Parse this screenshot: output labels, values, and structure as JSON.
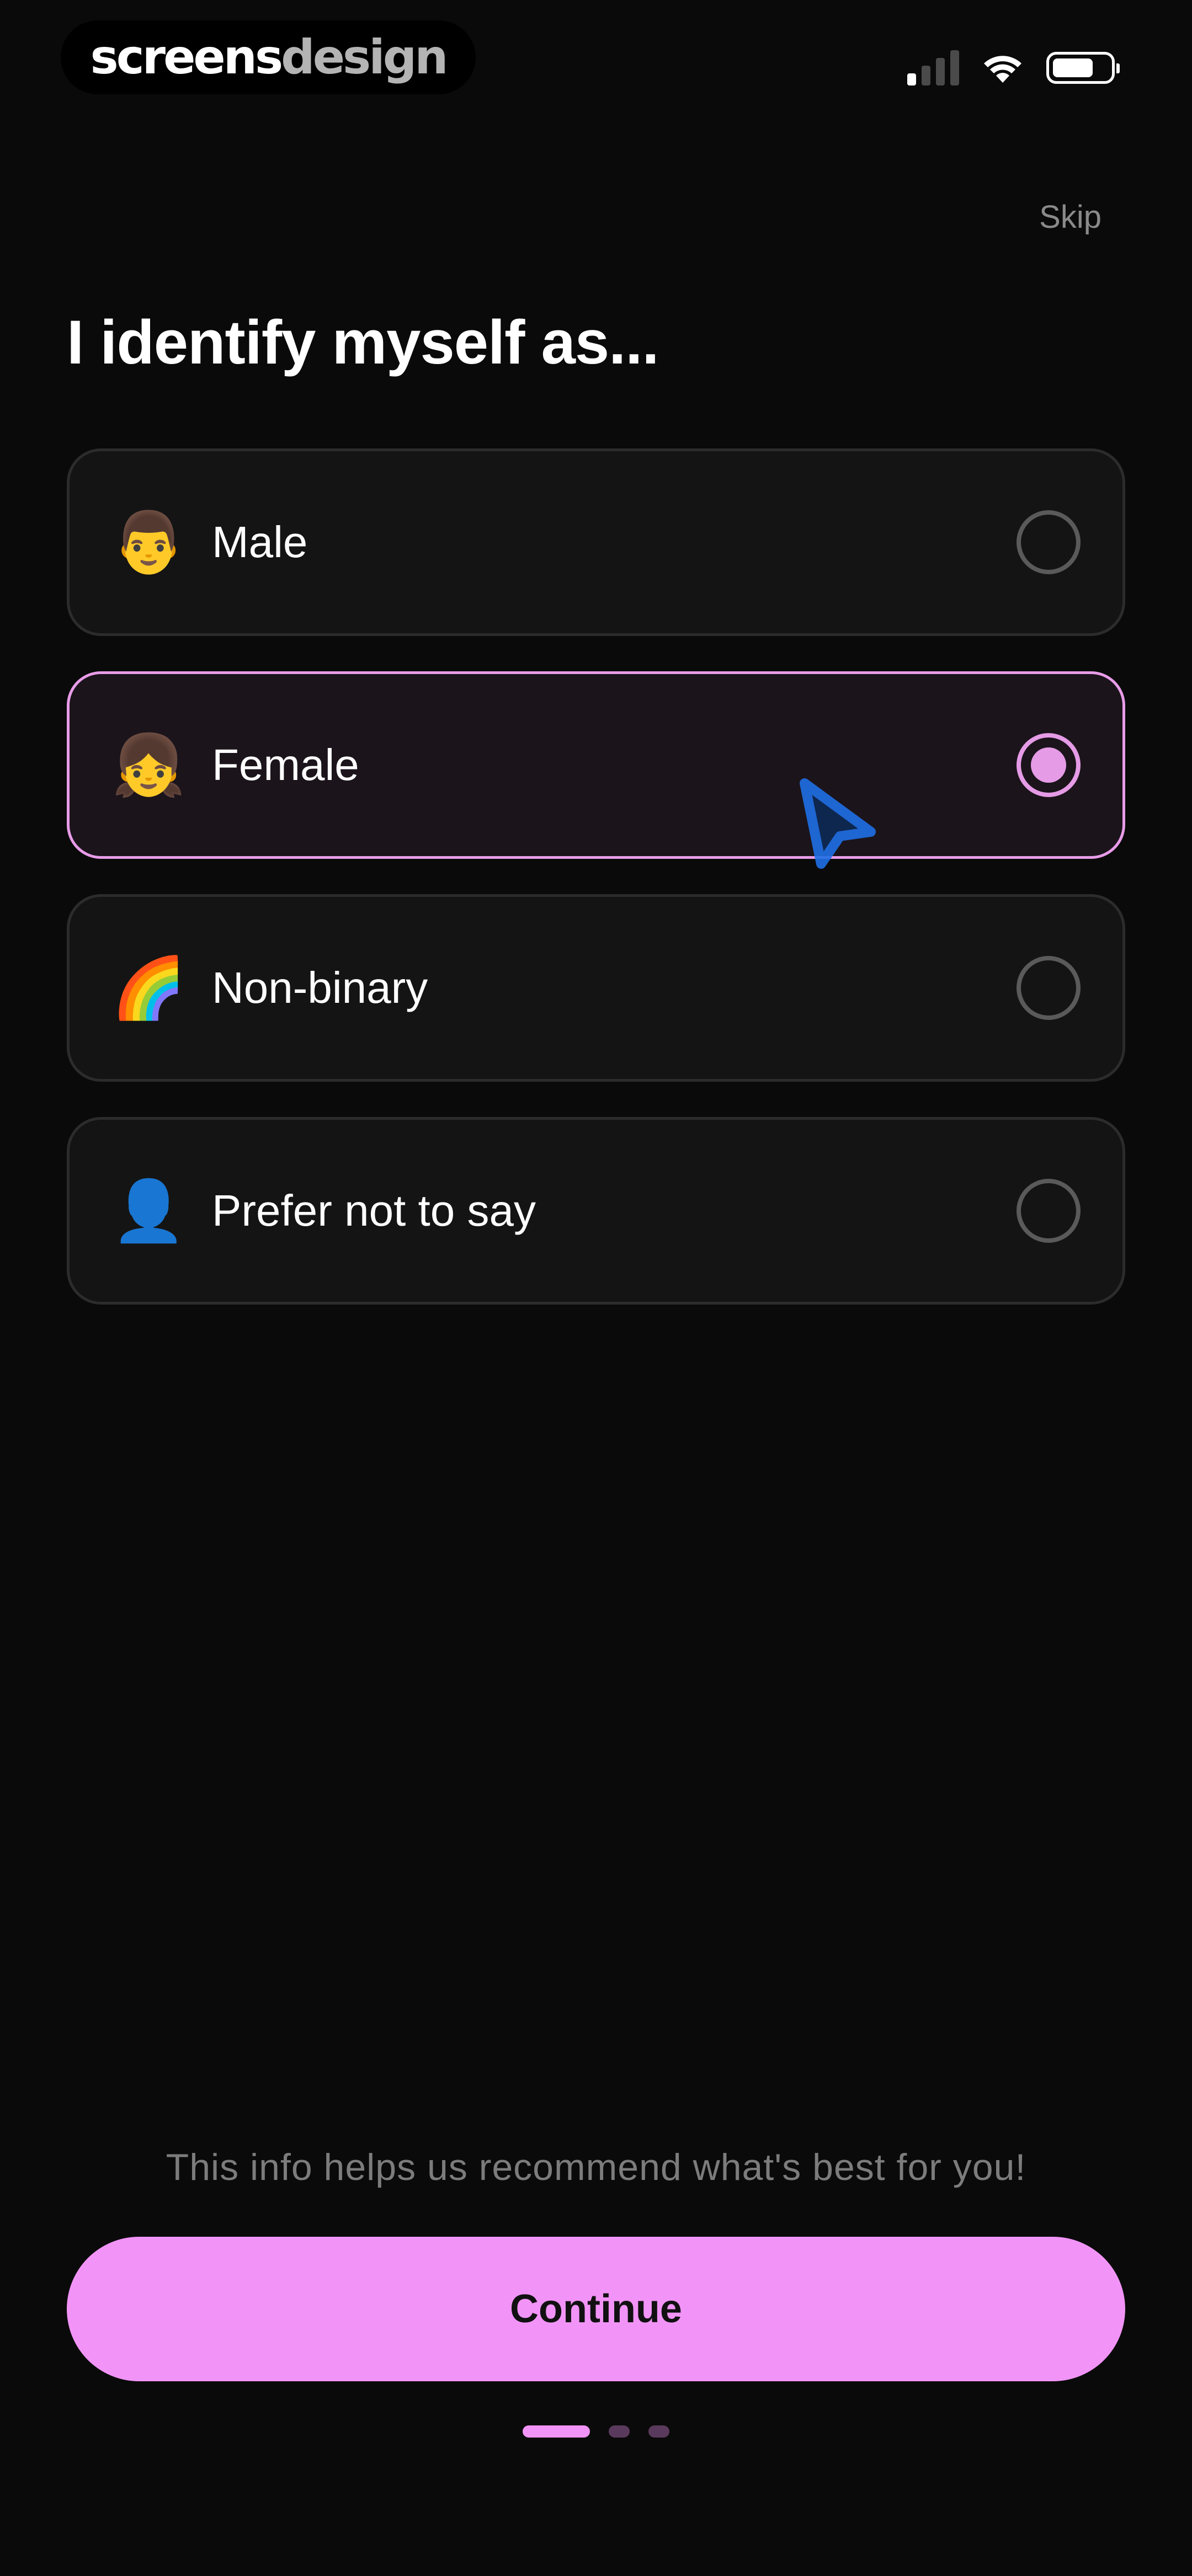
{
  "status_bar": {
    "brand_part1": "screens",
    "brand_part2": "design",
    "signal_icon": "cellular-signal-icon",
    "signal_bars_active": 1,
    "signal_bars_total": 4,
    "wifi_icon": "wifi-icon",
    "battery_icon": "battery-icon",
    "battery_level": 0.72
  },
  "header": {
    "skip_label": "Skip",
    "title": "I identify myself as..."
  },
  "options": [
    {
      "icon": "man-emoji-icon",
      "emoji": "👨",
      "label": "Male",
      "selected": false
    },
    {
      "icon": "girl-emoji-icon",
      "emoji": "👧",
      "label": "Female",
      "selected": true
    },
    {
      "icon": "rainbow-emoji-icon",
      "emoji": "🌈",
      "label": "Non-binary",
      "selected": false
    },
    {
      "icon": "bust-silhouette-icon",
      "emoji": "👤",
      "label": "Prefer not to say",
      "selected": false
    }
  ],
  "footer": {
    "helper_text": "This info helps us recommend what's best for you!",
    "continue_label": "Continue",
    "pager_total": 3,
    "pager_active_index": 0
  },
  "colors": {
    "background": "#0a0a0a",
    "accent": "#f294f7",
    "selected_border": "#e89ce8",
    "cursor": "#1f6fe6"
  }
}
